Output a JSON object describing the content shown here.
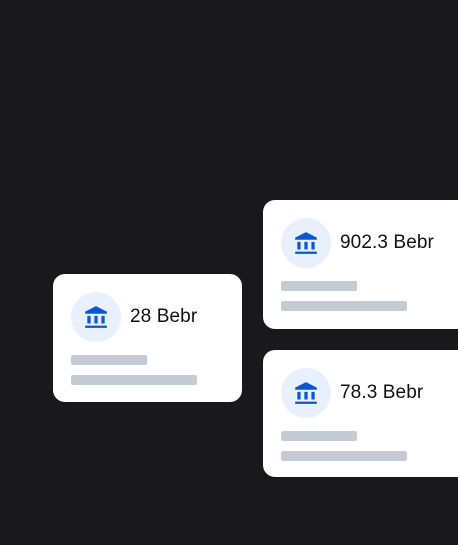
{
  "colors": {
    "background": "#19191b",
    "card": "#ffffff",
    "icon_circle": "#e8f0fe",
    "icon": "#0b57d0",
    "placeholder_line": "#c5cbd3",
    "text": "#111111"
  },
  "cards": [
    {
      "amount": "28 Bebr",
      "icon": "bank-icon"
    },
    {
      "amount": "902.3 Bebr",
      "icon": "bank-icon"
    },
    {
      "amount": "78.3 Bebr",
      "icon": "bank-icon"
    }
  ]
}
